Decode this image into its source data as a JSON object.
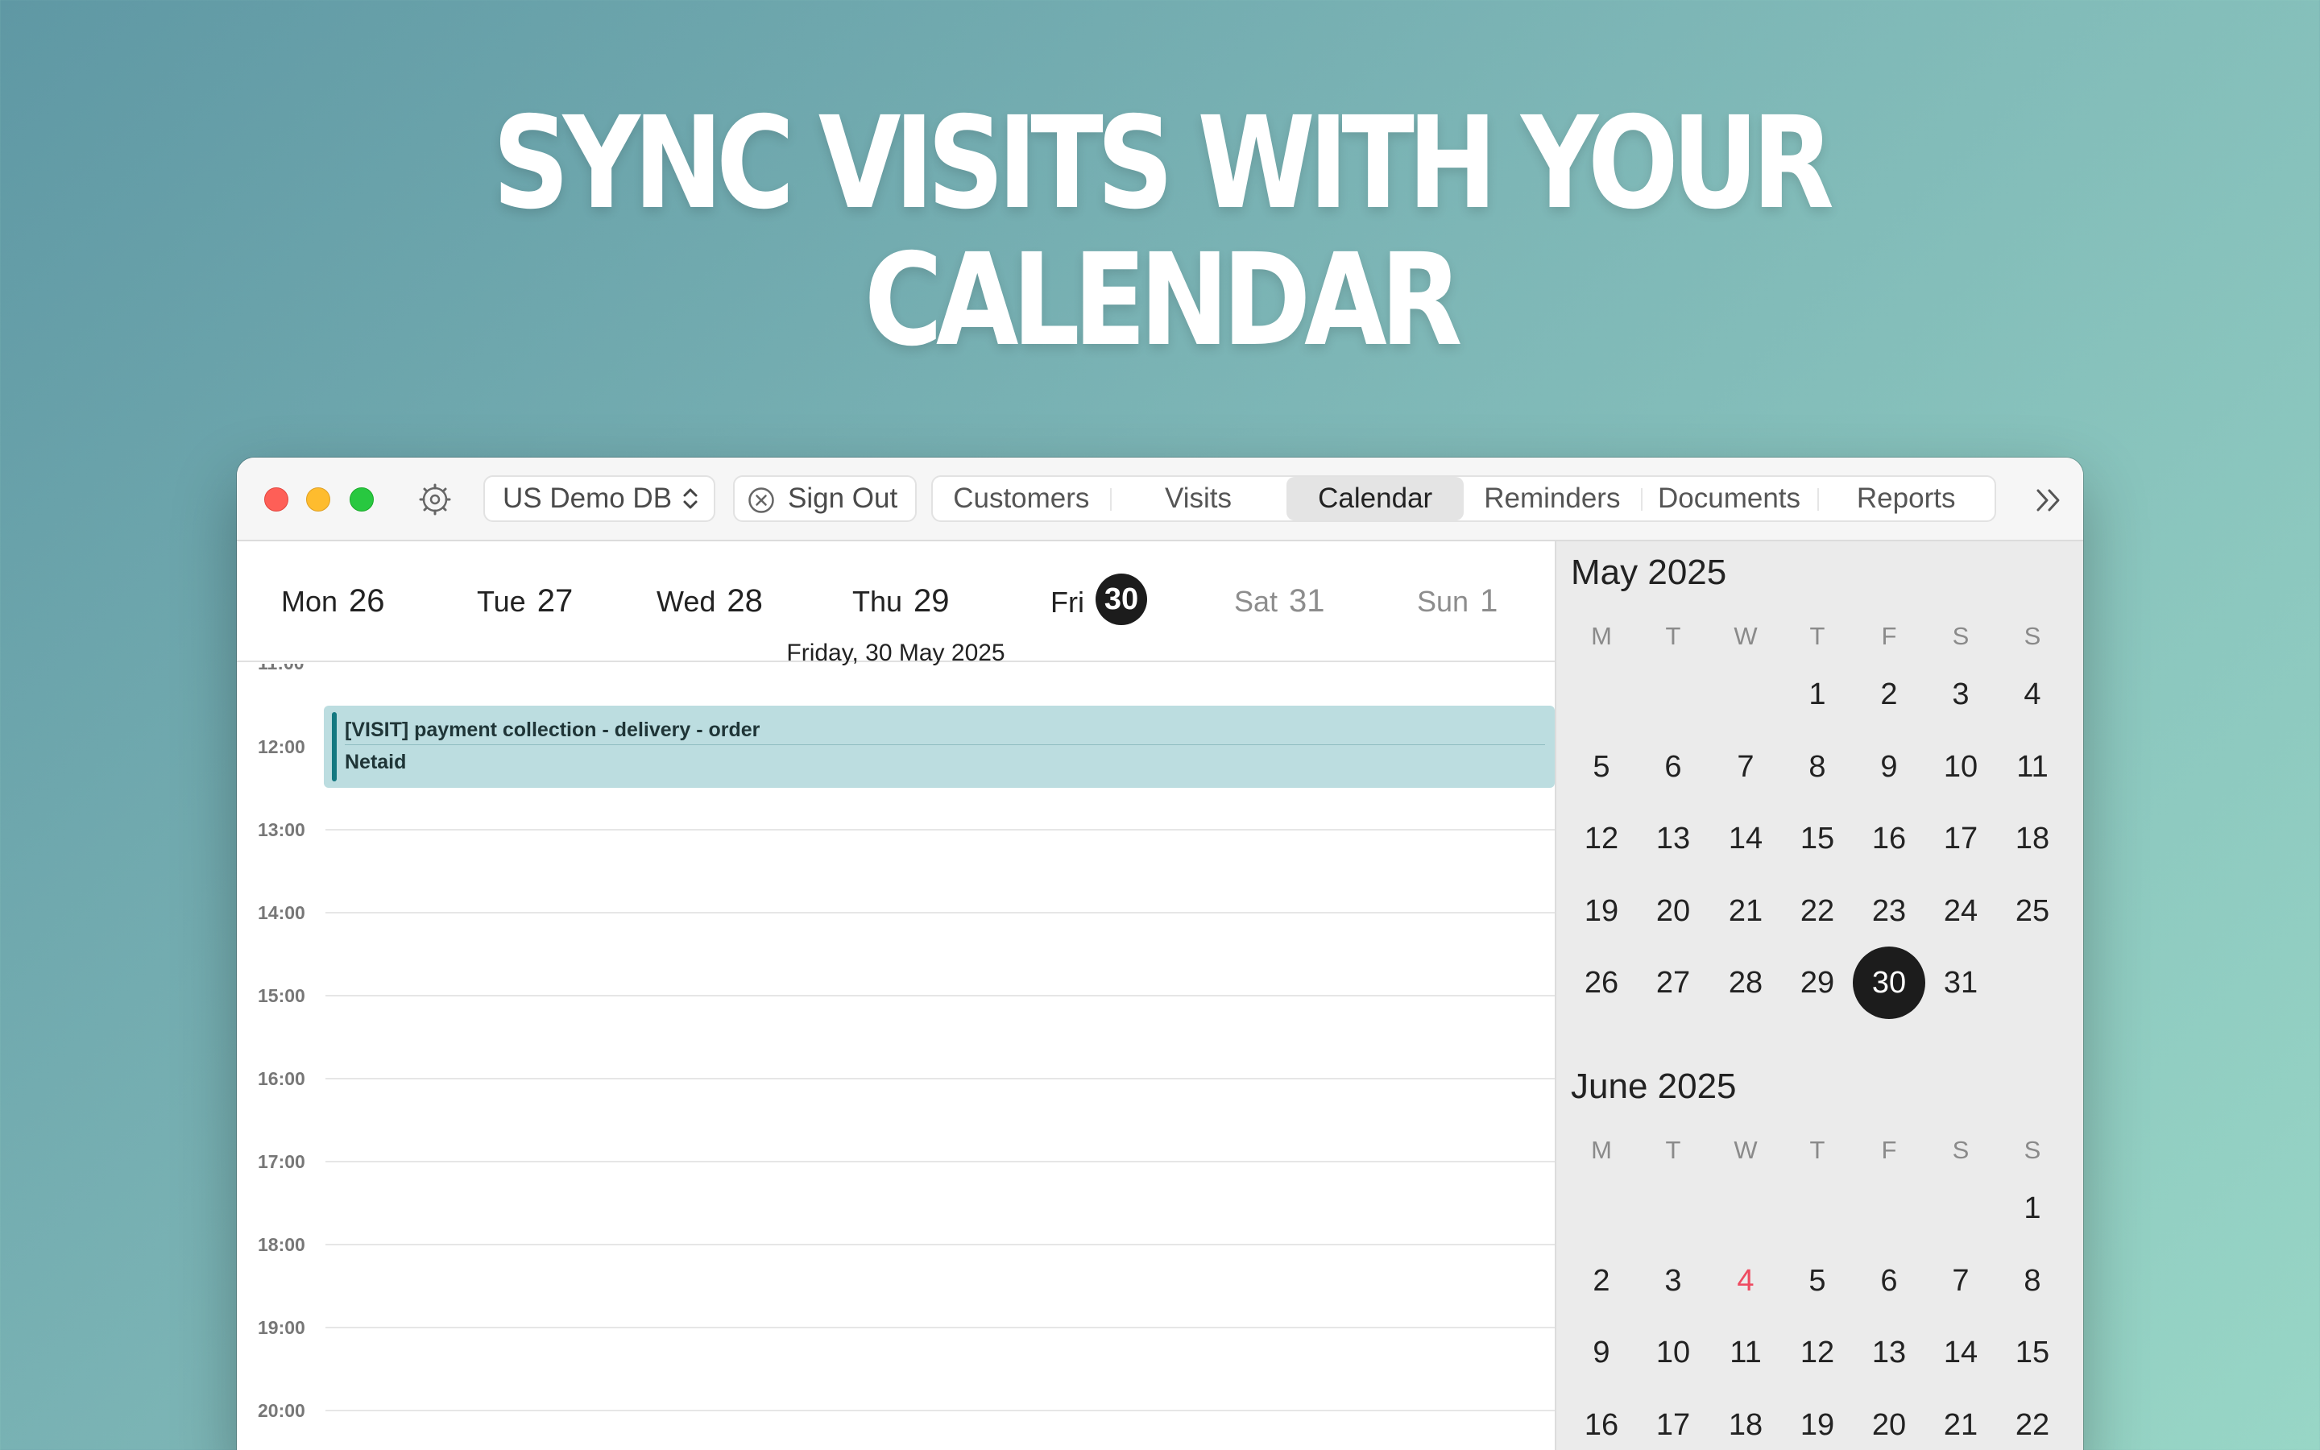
{
  "headline": "SYNC VISITS WITH YOUR CALENDAR",
  "toolbar": {
    "db_label": "US Demo DB",
    "sign_out_label": "Sign Out",
    "nav": [
      "Customers",
      "Visits",
      "Calendar",
      "Reminders",
      "Documents",
      "Reports"
    ],
    "active_nav": "Calendar"
  },
  "week": {
    "days": [
      {
        "name": "Mon",
        "num": "26"
      },
      {
        "name": "Tue",
        "num": "27"
      },
      {
        "name": "Wed",
        "num": "28"
      },
      {
        "name": "Thu",
        "num": "29"
      },
      {
        "name": "Fri",
        "num": "30"
      },
      {
        "name": "Sat",
        "num": "31"
      },
      {
        "name": "Sun",
        "num": "1"
      }
    ],
    "full_date": "Friday, 30 May 2025"
  },
  "timeline": {
    "hours": [
      "11:00",
      "12:00",
      "13:00",
      "14:00",
      "15:00",
      "16:00",
      "17:00",
      "18:00",
      "19:00",
      "20:00"
    ],
    "event": {
      "title": "[VISIT] payment collection - delivery - order",
      "subtitle": "Netaid",
      "color": "#bcdde0",
      "accent": "#137880"
    }
  },
  "mini_calendar": {
    "weekday_headers": [
      "M",
      "T",
      "W",
      "T",
      "F",
      "S",
      "S"
    ],
    "months": [
      {
        "title": "May 2025",
        "weeks": [
          [
            "",
            "",
            "",
            "1",
            "2",
            "3",
            "4"
          ],
          [
            "5",
            "6",
            "7",
            "8",
            "9",
            "10",
            "11"
          ],
          [
            "12",
            "13",
            "14",
            "15",
            "16",
            "17",
            "18"
          ],
          [
            "19",
            "20",
            "21",
            "22",
            "23",
            "24",
            "25"
          ],
          [
            "26",
            "27",
            "28",
            "29",
            "30",
            "31",
            ""
          ]
        ],
        "selected": "30"
      },
      {
        "title": "June 2025",
        "weeks": [
          [
            "",
            "",
            "",
            "",
            "",
            "",
            "1"
          ],
          [
            "2",
            "3",
            "4",
            "5",
            "6",
            "7",
            "8"
          ],
          [
            "9",
            "10",
            "11",
            "12",
            "13",
            "14",
            "15"
          ],
          [
            "16",
            "17",
            "18",
            "19",
            "20",
            "21",
            "22"
          ]
        ],
        "highlight_red": "4",
        "highlight_color": "#ee4b61"
      }
    ]
  }
}
